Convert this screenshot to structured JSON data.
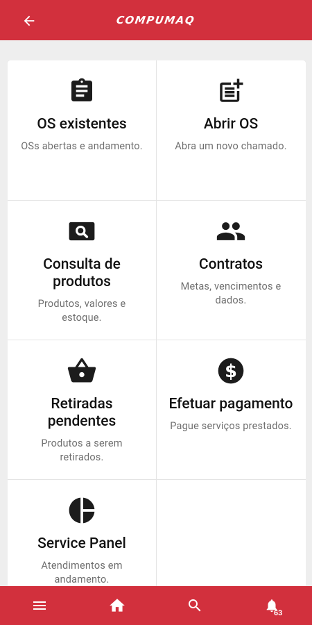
{
  "header": {
    "brand": "COMPUMAQ",
    "back_icon": "arrow-left-icon"
  },
  "tiles": [
    {
      "title": "OS existentes",
      "desc": "OSs abertas e andamento.",
      "icon": "clipboard-icon"
    },
    {
      "title": "Abrir OS",
      "desc": "Abra um novo chamado.",
      "icon": "note-add-icon"
    },
    {
      "title": "Consulta de produtos",
      "desc": "Produtos, valores e estoque.",
      "icon": "search-box-icon"
    },
    {
      "title": "Contratos",
      "desc": "Metas, vencimentos e dados.",
      "icon": "people-icon"
    },
    {
      "title": "Retiradas pendentes",
      "desc": "Produtos a serem retirados.",
      "icon": "basket-icon"
    },
    {
      "title": "Efetuar pagamento",
      "desc": "Pague serviços prestados.",
      "icon": "dollar-circle-icon"
    },
    {
      "title": "Service Panel",
      "desc": "Atendimentos em andamento.",
      "icon": "pie-chart-icon"
    }
  ],
  "bottom_nav": {
    "items": [
      "menu-icon",
      "home-icon",
      "search-icon",
      "bell-icon"
    ],
    "notification_count": "63"
  },
  "colors": {
    "primary": "#d2303d",
    "background": "#eeeeee",
    "card": "#ffffff"
  }
}
